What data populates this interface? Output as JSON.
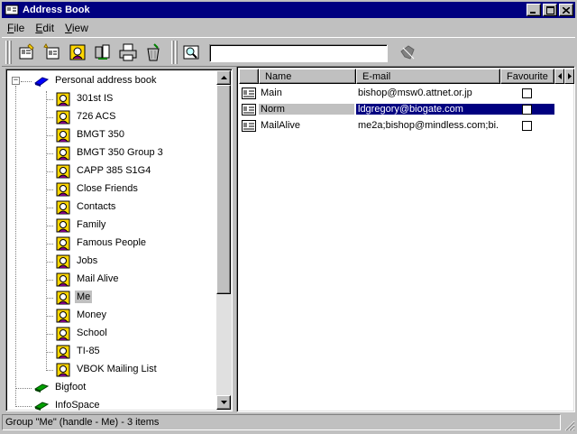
{
  "window": {
    "title": "Address Book"
  },
  "menu": [
    {
      "key": "F",
      "rest": "ile"
    },
    {
      "key": "E",
      "rest": "dit"
    },
    {
      "key": "V",
      "rest": "iew"
    }
  ],
  "toolbar": {
    "buttons": [
      "new-contact-icon",
      "new-group-icon",
      "properties-icon",
      "find-icon",
      "print-icon",
      "delete-icon",
      "search-icon",
      "disabled-action-icon"
    ],
    "search_value": ""
  },
  "tree": {
    "root": "Personal address book",
    "groups": [
      "301st IS",
      "726 ACS",
      "BMGT 350",
      "BMGT 350 Group 3",
      "CAPP 385 S1G4",
      "Close Friends",
      "Contacts",
      "Family",
      "Famous People",
      "Jobs",
      "Mail Alive",
      "Me",
      "Money",
      "School",
      "TI-85",
      "VBOK Mailing List"
    ],
    "selected_group": "Me",
    "directories": [
      "Bigfoot",
      "InfoSpace"
    ]
  },
  "list": {
    "columns": [
      "Name",
      "E-mail",
      "Favourite"
    ],
    "rows": [
      {
        "name": "Main",
        "email": "bishop@msw0.attnet.or.jp",
        "favourite": false
      },
      {
        "name": "Norm",
        "email": "ldgregory@biogate.com",
        "favourite": false
      },
      {
        "name": "MailAlive",
        "email": "me2a;bishop@mindless.com;bi...",
        "favourite": false
      }
    ],
    "selected_row": 1
  },
  "status": {
    "text": "Group \"Me\" (handle - Me) - 3 items"
  },
  "colors": {
    "titlebar": "#000080",
    "face": "#c0c0c0",
    "selection": "#000080"
  }
}
